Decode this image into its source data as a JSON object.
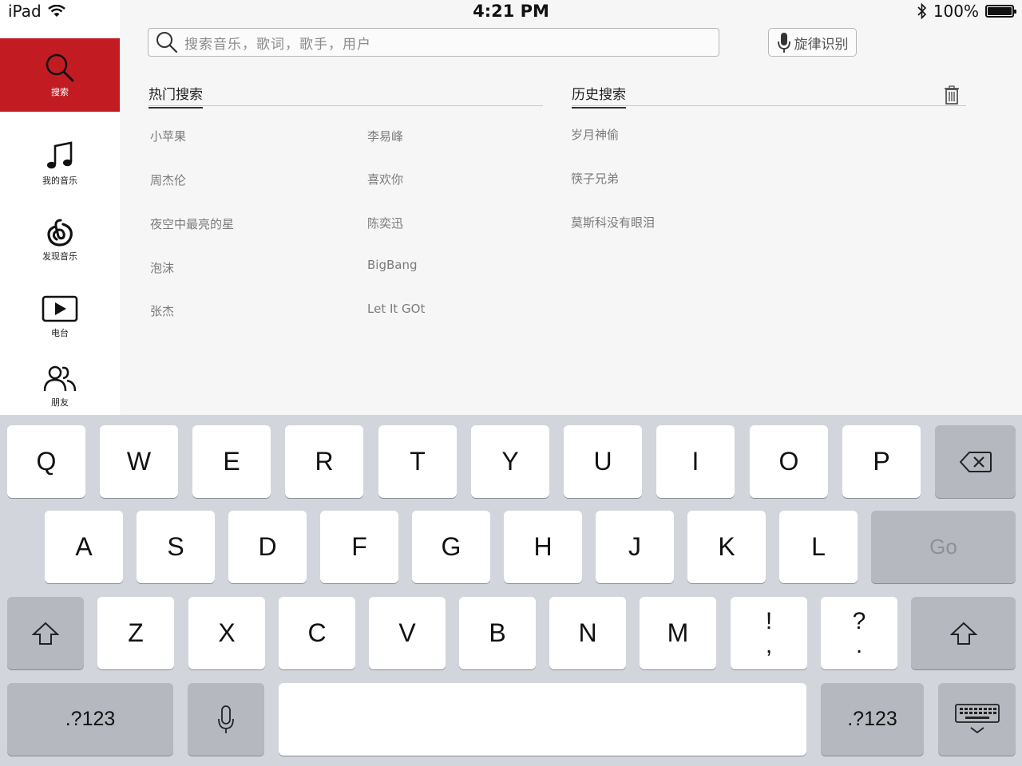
{
  "status_bar": {
    "device": "iPad",
    "time": "4:21 PM",
    "battery": "100%"
  },
  "sidebar": {
    "items": [
      {
        "label": "搜索",
        "icon": "search-icon",
        "active": true
      },
      {
        "label": "我的音乐",
        "icon": "music-note-icon"
      },
      {
        "label": "发现音乐",
        "icon": "netease-logo-icon"
      },
      {
        "label": "电台",
        "icon": "play-box-icon"
      },
      {
        "label": "朋友",
        "icon": "friends-icon"
      }
    ]
  },
  "search": {
    "placeholder": "搜索音乐，歌词，歌手，用户",
    "voice_label": "旋律识别"
  },
  "hot_search": {
    "title": "热门搜索",
    "items": [
      "小苹果",
      "李易峰",
      "周杰伦",
      "喜欢你",
      "夜空中最亮的星",
      "陈奕迅",
      "泡沫",
      "BigBang",
      "张杰",
      "Let It GOt"
    ]
  },
  "history": {
    "title": "历史搜索",
    "items": [
      "岁月神偷",
      "筷子兄弟",
      "莫斯科没有眼泪"
    ]
  },
  "keyboard": {
    "row1": [
      "Q",
      "W",
      "E",
      "R",
      "T",
      "Y",
      "U",
      "I",
      "O",
      "P"
    ],
    "row2": [
      "A",
      "S",
      "D",
      "F",
      "G",
      "H",
      "J",
      "K",
      "L"
    ],
    "go": "Go",
    "row3": [
      "Z",
      "X",
      "C",
      "V",
      "B",
      "N",
      "M"
    ],
    "punct1": [
      "!",
      ","
    ],
    "punct2": [
      "?",
      "."
    ],
    "num_label": ".?123"
  },
  "colors": {
    "accent": "#c21c22",
    "keyboard_bg": "#d2d5db"
  }
}
